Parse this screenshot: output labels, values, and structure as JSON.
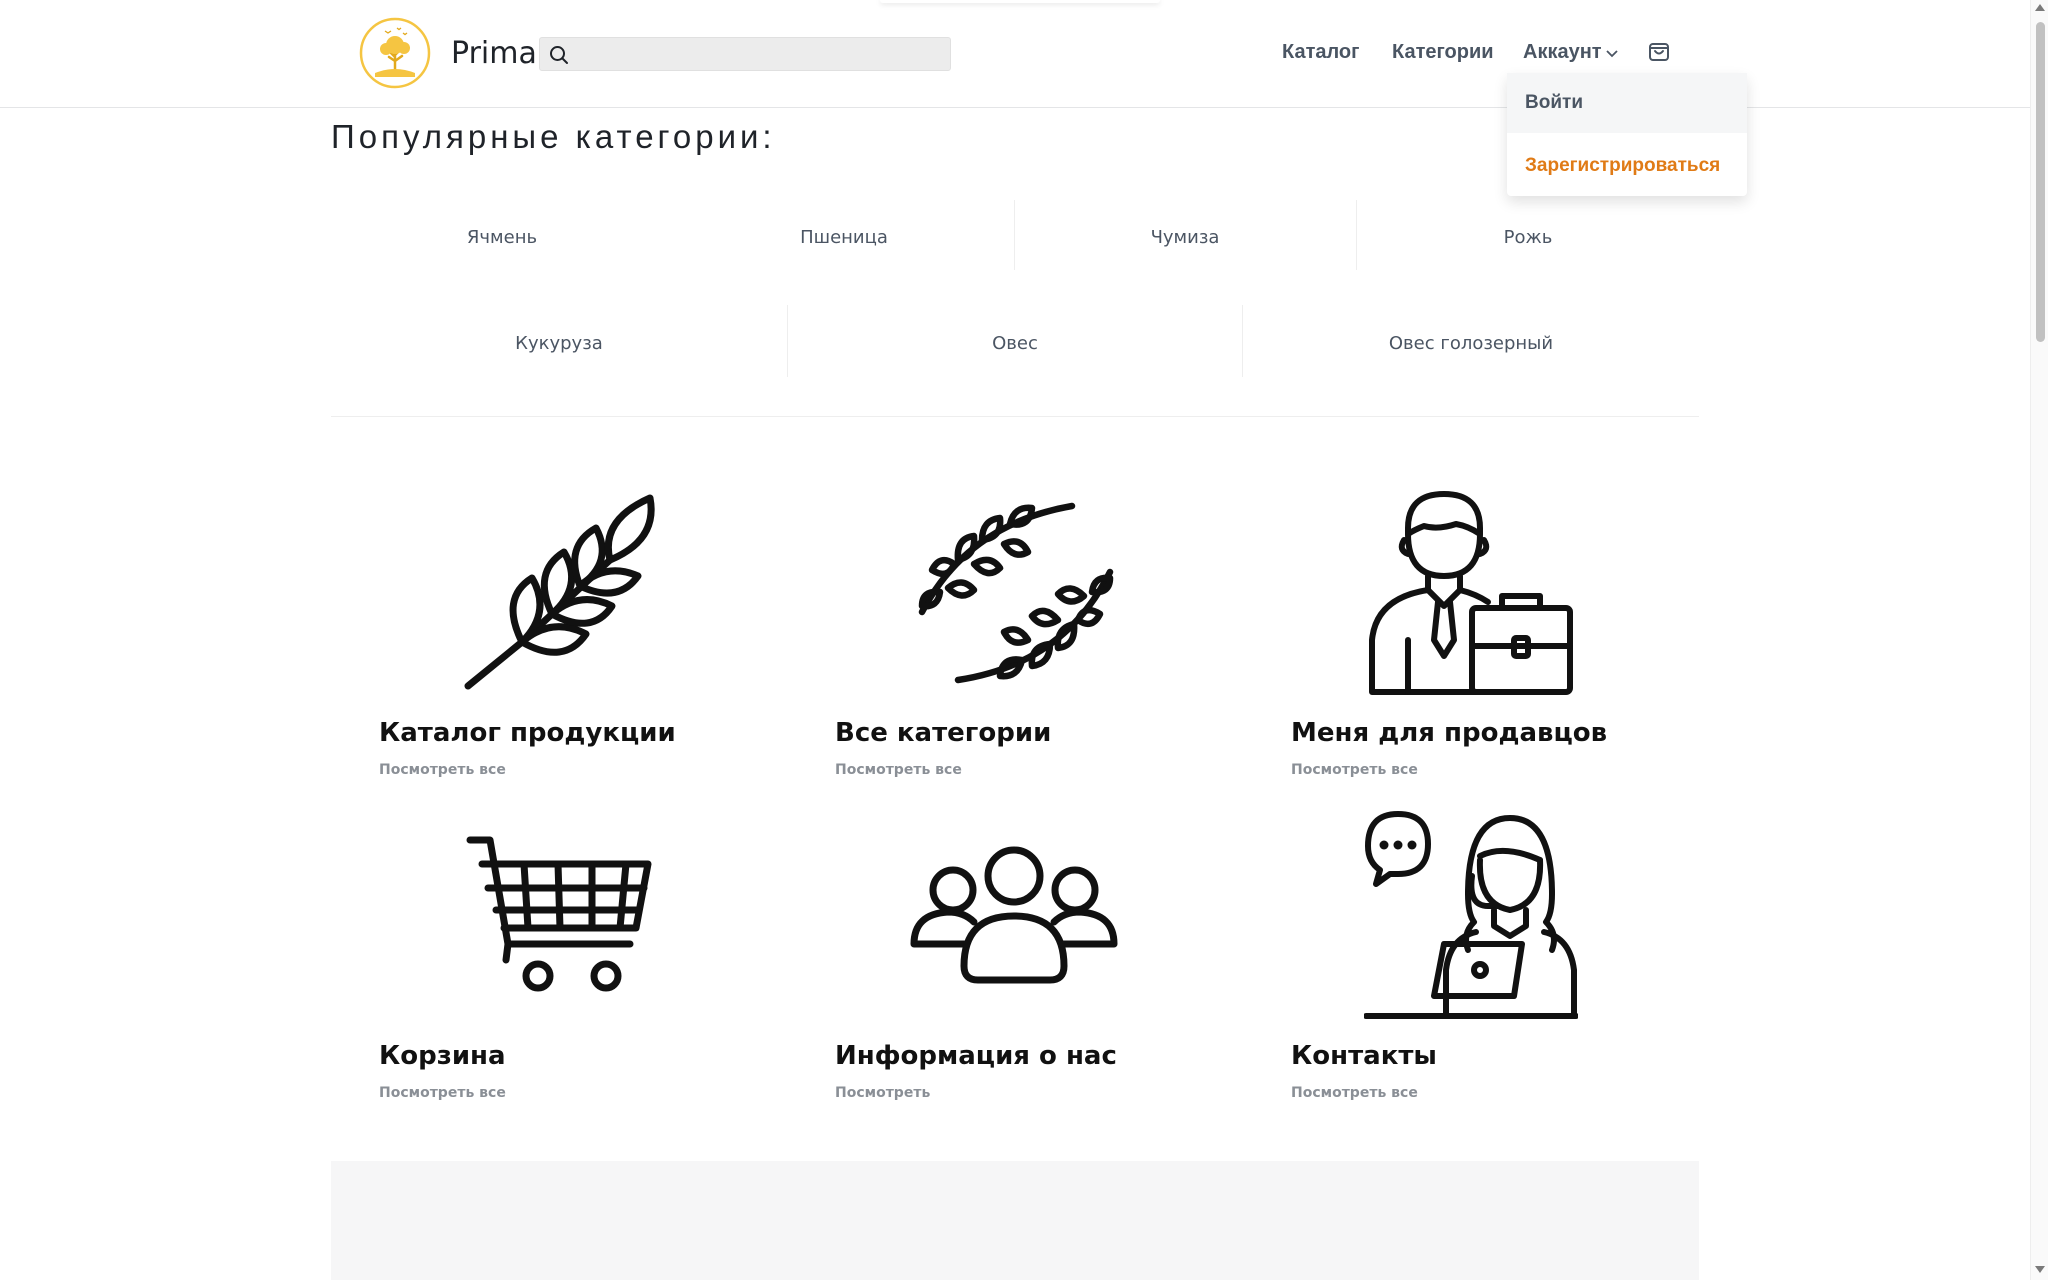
{
  "header": {
    "brand": "Prima",
    "search_placeholder": "",
    "nav": {
      "catalog": "Каталог",
      "categories": "Категории",
      "account": "Аккаунт"
    },
    "account_menu": {
      "login": "Войти",
      "register": "Зарегистрироваться"
    }
  },
  "colors": {
    "accent": "#e07b16",
    "logo": "#f5c542"
  },
  "popular": {
    "title": "Популярные категории:",
    "row1": [
      "Ячмень",
      "Пшеница",
      "Чумиза",
      "Рожь"
    ],
    "row2": [
      "Кукуруза",
      "Овес",
      "Овес голозерный"
    ]
  },
  "tiles": [
    {
      "icon": "wheat-icon",
      "title": "Каталог продукции",
      "link": "Посмотреть все"
    },
    {
      "icon": "laurel-icon",
      "title": "Все категории",
      "link": "Посмотреть все"
    },
    {
      "icon": "businessman-icon",
      "title": "Меня для продавцов",
      "link": "Посмотреть все"
    },
    {
      "icon": "shopping-cart-icon",
      "title": "Корзина",
      "link": "Посмотреть все"
    },
    {
      "icon": "group-icon",
      "title": "Информация о нас",
      "link": "Посмотреть"
    },
    {
      "icon": "support-agent-icon",
      "title": "Контакты",
      "link": "Посмотреть все"
    }
  ]
}
